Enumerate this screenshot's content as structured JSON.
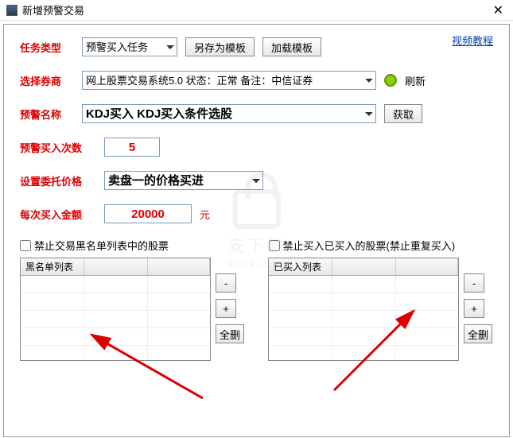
{
  "window": {
    "title": "新增预警交易"
  },
  "links": {
    "video_tutorial": "视频教程"
  },
  "labels": {
    "task_type": "任务类型",
    "broker": "选择券商",
    "alert_name": "预警名称",
    "buy_count": "预警买入次数",
    "price_setting": "设置委托价格",
    "amount": "每次买入金额",
    "unit": "元"
  },
  "fields": {
    "task_type": "预警买入任务",
    "broker": "网上股票交易系统5.0  状态：正常  备注：中信证券",
    "alert_name": "KDJ买入  KDJ买入条件选股",
    "buy_count": "5",
    "price_setting": "卖盘一的价格买进",
    "amount": "20000"
  },
  "buttons": {
    "save_template": "另存为模板",
    "load_template": "加载模板",
    "refresh": "刷新",
    "fetch": "获取",
    "minus": "-",
    "plus": "+",
    "clear_all": "全删"
  },
  "checks": {
    "blacklist": "禁止交易黑名单列表中的股票",
    "no_repeat": "禁止买入已买入的股票(禁止重复买入)"
  },
  "lists": {
    "blacklist_header": "黑名单列表",
    "bought_header": "已买入列表"
  },
  "watermark": {
    "line1": "安下载",
    "line2": "anxz.com"
  }
}
